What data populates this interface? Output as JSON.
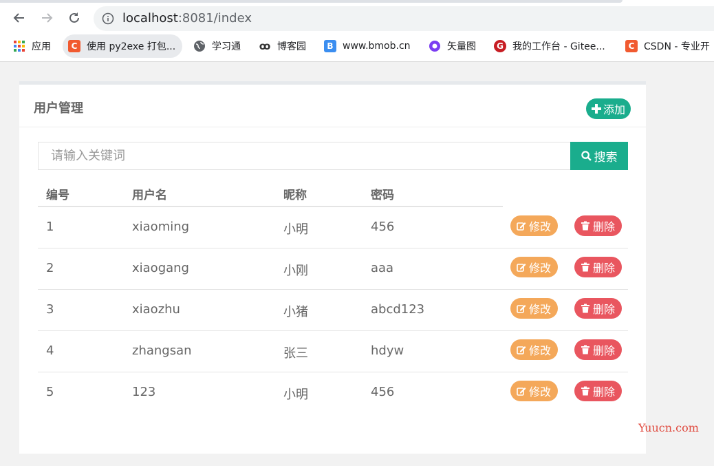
{
  "browser": {
    "url_host": "localhost",
    "url_rest": ":8081/index",
    "bookmarks": [
      {
        "label": "应用",
        "icon": "apps-grid-icon",
        "glyph": ""
      },
      {
        "label": "使用 py2exe 打包...",
        "icon": "csdn-icon",
        "glyph": "C",
        "color": "#f15a30"
      },
      {
        "label": "学习通",
        "icon": "globe-icon",
        "glyph": ""
      },
      {
        "label": "博客园",
        "icon": "cnblogs-icon",
        "glyph": "ꝏ"
      },
      {
        "label": "www.bmob.cn",
        "icon": "bmob-icon",
        "glyph": "B",
        "color": "#3b8ef0"
      },
      {
        "label": "矢量图",
        "icon": "iconfont-icon",
        "glyph": "",
        "color": "#7b3df2"
      },
      {
        "label": "我的工作台 - Gitee...",
        "icon": "gitee-icon",
        "glyph": "G",
        "color": "#c71d23"
      },
      {
        "label": "CSDN - 专业开",
        "icon": "csdn-icon",
        "glyph": "C",
        "color": "#f15a30"
      }
    ]
  },
  "panel": {
    "title": "用户管理",
    "add_label": "添加"
  },
  "search": {
    "placeholder": "请输入关键词",
    "button_label": "搜索"
  },
  "table": {
    "columns": [
      "编号",
      "用户名",
      "昵称",
      "密码"
    ],
    "rows": [
      {
        "id": "1",
        "username": "xiaoming",
        "nickname": "小明",
        "password": "456"
      },
      {
        "id": "2",
        "username": "xiaogang",
        "nickname": "小刚",
        "password": "aaa"
      },
      {
        "id": "3",
        "username": "xiaozhu",
        "nickname": "小猪",
        "password": "abcd123"
      },
      {
        "id": "4",
        "username": "zhangsan",
        "nickname": "张三",
        "password": "hdyw"
      },
      {
        "id": "5",
        "username": "123",
        "nickname": "小明",
        "password": "456"
      }
    ],
    "edit_label": "修改",
    "delete_label": "删除"
  },
  "watermark": "Yuucn.com",
  "colors": {
    "primary": "#1aad8d",
    "edit": "#f4a85a",
    "delete": "#e9565f"
  }
}
